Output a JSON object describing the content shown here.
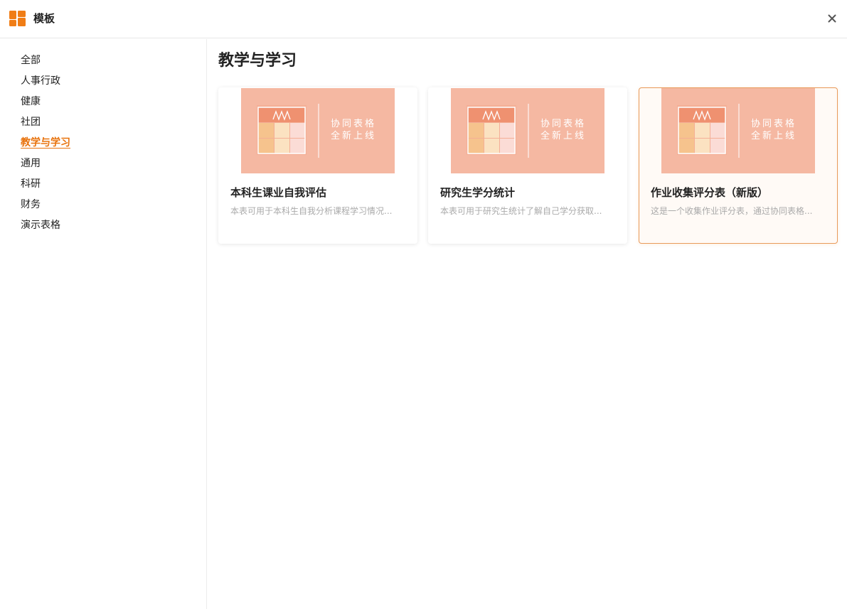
{
  "header": {
    "title": "模板",
    "close_label": "×"
  },
  "sidebar": {
    "items": [
      {
        "label": "全部"
      },
      {
        "label": "人事行政"
      },
      {
        "label": "健康"
      },
      {
        "label": "社团"
      },
      {
        "label": "教学与学习",
        "active": true
      },
      {
        "label": "通用"
      },
      {
        "label": "科研"
      },
      {
        "label": "财务"
      },
      {
        "label": "演示表格"
      }
    ]
  },
  "main": {
    "title": "教学与学习",
    "thumbnail": {
      "line1": "协同表格",
      "line2": "全新上线"
    },
    "cards": [
      {
        "title": "本科生课业自我评估",
        "desc": "本表可用于本科生自我分析课程学习情况..."
      },
      {
        "title": "研究生学分统计",
        "desc": "本表可用于研究生统计了解自己学分获取..."
      },
      {
        "title": "作业收集评分表（新版）",
        "desc": "这是一个收集作业评分表，通过协同表格..."
      }
    ]
  },
  "colors": {
    "accent": "#e8720c",
    "thumb_bg": "#f5b8a2",
    "card_highlight_border": "#e89a5a"
  }
}
